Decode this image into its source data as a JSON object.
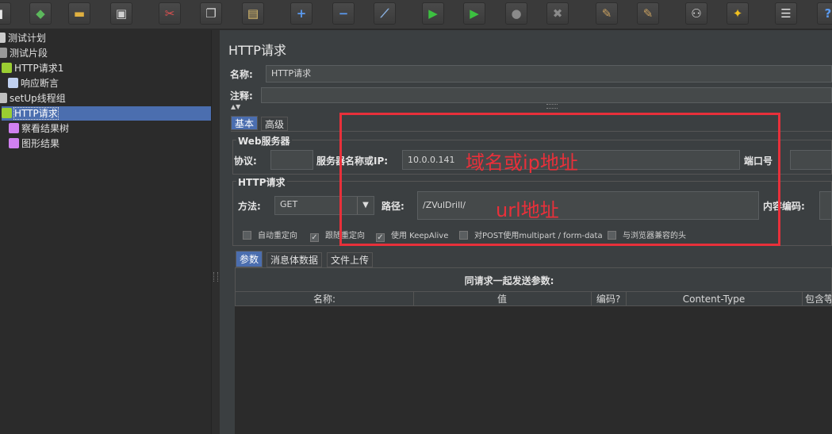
{
  "toolbar": {
    "buttons": [
      {
        "icon": "new-icon",
        "glyph": "▮",
        "color": "#e8e8e8"
      },
      {
        "icon": "templates-icon",
        "glyph": "◆",
        "color": "#5cb85c"
      },
      {
        "icon": "open-icon",
        "glyph": "▬",
        "color": "#e0b040"
      },
      {
        "icon": "save-icon",
        "glyph": "▣",
        "color": "#d0d0d0"
      },
      {
        "icon": "cut-icon",
        "glyph": "✂",
        "color": "#e05050"
      },
      {
        "icon": "copy-icon",
        "glyph": "❐",
        "color": "#d0d0d0"
      },
      {
        "icon": "paste-icon",
        "glyph": "▤",
        "color": "#e0c070"
      },
      {
        "icon": "expand-icon",
        "glyph": "+",
        "color": "#5a9af0"
      },
      {
        "icon": "collapse-icon",
        "glyph": "−",
        "color": "#5a9af0"
      },
      {
        "icon": "toggle-icon",
        "glyph": "⟋",
        "color": "#8ab0e0"
      },
      {
        "icon": "start-icon",
        "glyph": "▶",
        "color": "#3cc040"
      },
      {
        "icon": "start-no-pauses-icon",
        "glyph": "▶",
        "color": "#3cc040"
      },
      {
        "icon": "stop-icon",
        "glyph": "●",
        "color": "#8a8a8a"
      },
      {
        "icon": "shutdown-icon",
        "glyph": "✖",
        "color": "#8a8a8a"
      },
      {
        "icon": "clear-icon",
        "glyph": "✎",
        "color": "#c8a060"
      },
      {
        "icon": "clear-all-icon",
        "glyph": "✎",
        "color": "#c8a060"
      },
      {
        "icon": "search-icon",
        "glyph": "⚇",
        "color": "#e0e0e0"
      },
      {
        "icon": "reset-search-icon",
        "glyph": "✦",
        "color": "#f0c020"
      },
      {
        "icon": "function-helper-icon",
        "glyph": "☰",
        "color": "#e0e0e0"
      },
      {
        "icon": "help-icon",
        "glyph": "?",
        "color": "#5a9af0"
      }
    ]
  },
  "tree": {
    "nodes": [
      {
        "label": "测试计划",
        "icon": "test-plan-icon",
        "color": "#cccccc"
      },
      {
        "label": "测试片段",
        "icon": "test-fragment-icon",
        "color": "#999999"
      },
      {
        "label": "HTTP请求1",
        "icon": "sampler-icon",
        "color": "#9acd32"
      },
      {
        "label": "响应断言",
        "icon": "assertion-icon",
        "color": "#c0d0f0"
      },
      {
        "label": "setUp线程组",
        "icon": "gear-icon",
        "color": "#c0c0c0"
      },
      {
        "label": "HTTP请求",
        "icon": "sampler-icon",
        "color": "#9acd32",
        "selected": true
      },
      {
        "label": "察看结果树",
        "icon": "listener-icon",
        "color": "#d080f0"
      },
      {
        "label": "图形结果",
        "icon": "listener-icon",
        "color": "#d080f0"
      }
    ]
  },
  "panel": {
    "title": "HTTP请求",
    "name_label": "名称:",
    "name_value": "HTTP请求",
    "comment_label": "注释:",
    "tabs": [
      "基本",
      "高级"
    ],
    "web_server": {
      "legend": "Web服务器",
      "protocol_label": "协议:",
      "protocol_value": "",
      "server_label": "服务器名称或IP:",
      "server_value": "10.0.0.141",
      "port_label": "端口号"
    },
    "http_request": {
      "legend": "HTTP请求",
      "method_label": "方法:",
      "method_value": "GET",
      "path_label": "路径:",
      "path_value": "/ZVulDrill/",
      "encoding_label": "内容编码:"
    },
    "options": [
      {
        "label": "自动重定向",
        "checked": false
      },
      {
        "label": "跟随重定向",
        "checked": true
      },
      {
        "label": "使用 KeepAlive",
        "checked": true
      },
      {
        "label": "对POST使用multipart / form-data",
        "checked": false
      },
      {
        "label": "与浏览器兼容的头",
        "checked": false
      }
    ],
    "param_tabs": [
      "参数",
      "消息体数据",
      "文件上传"
    ],
    "params_caption": "同请求一起发送参数:",
    "columns": [
      "名称:",
      "值",
      "编码?",
      "Content-Type",
      "包含等"
    ]
  },
  "annotations": {
    "domain_label": "域名或ip地址",
    "url_label": "url地址",
    "color": "#e8303a"
  }
}
